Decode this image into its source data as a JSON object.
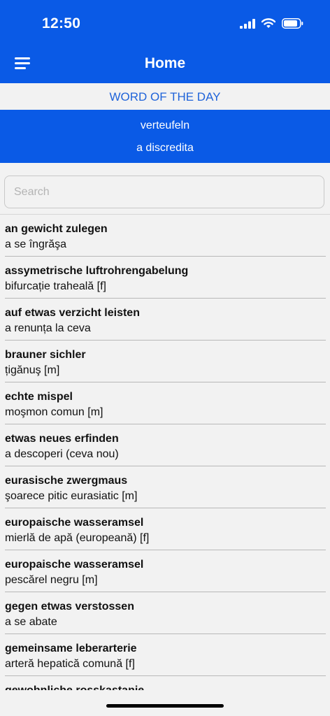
{
  "status_bar": {
    "time": "12:50"
  },
  "header": {
    "title": "Home"
  },
  "word_of_day": {
    "label": "WORD OF THE DAY",
    "word": "verteufeln",
    "translation": "a discredita"
  },
  "search": {
    "placeholder": "Search",
    "value": ""
  },
  "entries": [
    {
      "term": "an gewicht zulegen",
      "translation": "a se îngrăşa"
    },
    {
      "term": "assymetrische luftrohrengabelung",
      "translation": "bifurcație traheală [f]"
    },
    {
      "term": "auf etwas verzicht leisten",
      "translation": "a renunța la ceva"
    },
    {
      "term": "brauner sichler",
      "translation": "țigănuş [m]"
    },
    {
      "term": "echte mispel",
      "translation": "moşmon comun [m]"
    },
    {
      "term": "etwas neues erfinden",
      "translation": "a descoperi (ceva nou)"
    },
    {
      "term": "eurasische zwergmaus",
      "translation": "şoarece pitic eurasiatic [m]"
    },
    {
      "term": "europaische wasseramsel",
      "translation": "mierlă de apă (europeană) [f]"
    },
    {
      "term": "europaische wasseramsel",
      "translation": "pescărel negru [m]"
    },
    {
      "term": "gegen etwas verstossen",
      "translation": "a se abate"
    },
    {
      "term": "gemeinsame leberarterie",
      "translation": "arteră hepatică comună [f]"
    },
    {
      "term": "gewohnliche rosskastanie",
      "translation": ""
    }
  ]
}
